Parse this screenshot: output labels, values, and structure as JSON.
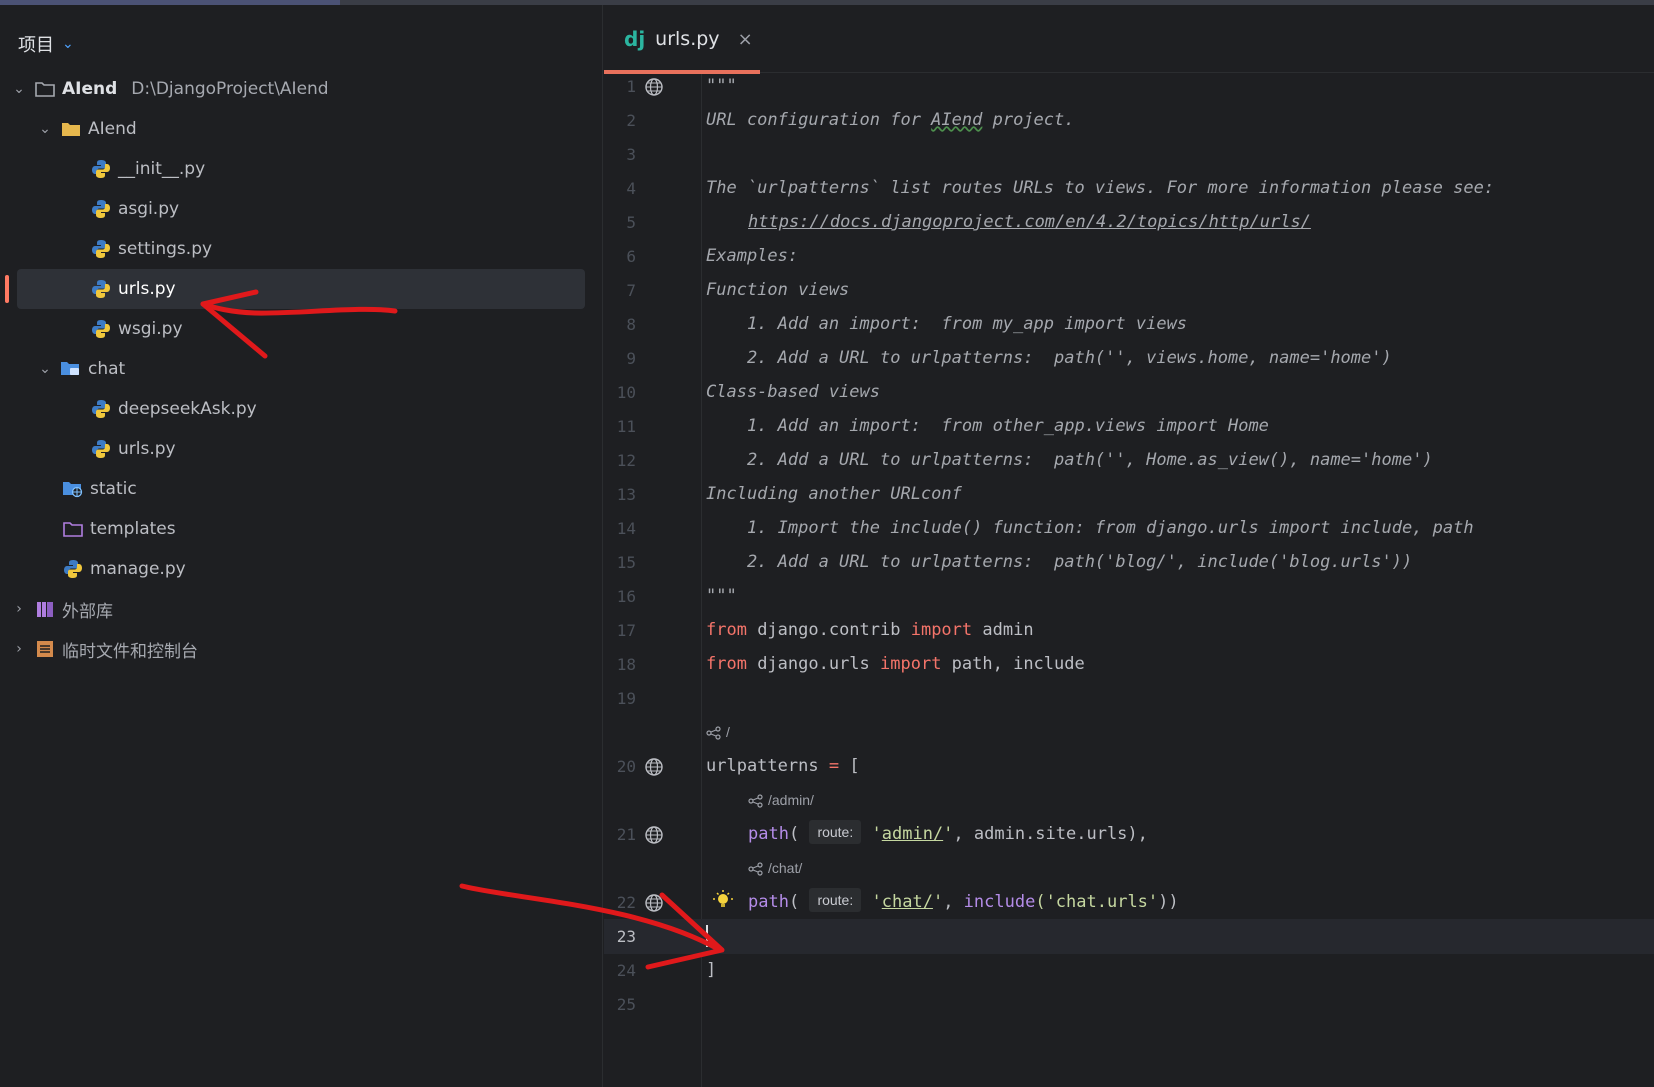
{
  "project_panel": {
    "title": "项目",
    "tree": [
      {
        "label": "AIend",
        "path": "D:\\DjangoProject\\AIend",
        "type": "root-folder",
        "expanded": true
      },
      {
        "label": "AIend",
        "type": "folder",
        "expanded": true
      },
      {
        "label": "__init__.py",
        "type": "python-file"
      },
      {
        "label": "asgi.py",
        "type": "python-file"
      },
      {
        "label": "settings.py",
        "type": "python-file"
      },
      {
        "label": "urls.py",
        "type": "python-file",
        "selected": true
      },
      {
        "label": "wsgi.py",
        "type": "python-file"
      },
      {
        "label": "chat",
        "type": "package-folder",
        "expanded": true
      },
      {
        "label": "deepseekAsk.py",
        "type": "python-file"
      },
      {
        "label": "urls.py",
        "type": "python-file"
      },
      {
        "label": "static",
        "type": "web-folder"
      },
      {
        "label": "templates",
        "type": "template-folder"
      },
      {
        "label": "manage.py",
        "type": "python-file"
      },
      {
        "label": "外部库",
        "type": "library",
        "expanded": false
      },
      {
        "label": "临时文件和控制台",
        "type": "scratches",
        "expanded": false
      }
    ]
  },
  "editor": {
    "tab": {
      "icon": "dj",
      "name": "urls.py",
      "close": "×"
    },
    "lines": {
      "n1": "1",
      "n2": "2",
      "n3": "3",
      "n4": "4",
      "n5": "5",
      "n6": "6",
      "n7": "7",
      "n8": "8",
      "n9": "9",
      "n10": "10",
      "n11": "11",
      "n12": "12",
      "n13": "13",
      "n14": "14",
      "n15": "15",
      "n16": "16",
      "n17": "17",
      "n18": "18",
      "n19": "19",
      "n20": "20",
      "n21": "21",
      "n22": "22",
      "n23": "23",
      "n24": "24",
      "n25": "25"
    },
    "code": {
      "l1": "\"\"\"",
      "l2a": "URL configuration for ",
      "l2b": "AIend",
      "l2c": " project.",
      "l4": "The `urlpatterns` list routes URLs to views. For more information please see:",
      "l5": "https://docs.djangoproject.com/en/4.2/topics/http/urls/",
      "l6": "Examples:",
      "l7": "Function views",
      "l8": "    1. Add an import:  from my_app import views",
      "l9": "    2. Add a URL to urlpatterns:  path('', views.home, name='home')",
      "l10": "Class-based views",
      "l11": "    1. Add an import:  from other_app.views import Home",
      "l12": "    2. Add a URL to urlpatterns:  path('', Home.as_view(), name='home')",
      "l13": "Including another URLconf",
      "l14": "    1. Import the include() function: from django.urls import include, path",
      "l15": "    2. Add a URL to urlpatterns:  path('blog/', include('blog.urls'))",
      "l16": "\"\"\"",
      "kw_from": "from",
      "kw_import": "import",
      "l17_mod": " django.contrib ",
      "l17_name": " admin",
      "l18_mod": " django.urls ",
      "l18_names": " path, include",
      "route_root": "/",
      "l20_name": "urlpatterns ",
      "l20_eq": "=",
      "l20_br": " [",
      "route_admin": "/admin/",
      "path_fn": "path",
      "paren_open": "( ",
      "hint_route": "route:",
      "quote": "'",
      "admin_str": "admin/",
      "l21_rest": ", admin.site.urls),",
      "route_chat": "/chat/",
      "chat_str": "chat/",
      "comma": ", ",
      "include_fn": "include",
      "chat_urls": "('chat.urls'",
      "l22_end": "))",
      "l24": "]"
    }
  },
  "colors": {
    "background": "#1e1f22",
    "keyword": "#f4746a",
    "function": "#b48ce8",
    "string": "#c5d7a0",
    "django_badge": "#2bb5a0",
    "tab_underline": "#e8715c",
    "annotation_arrows": "#e0191b"
  }
}
